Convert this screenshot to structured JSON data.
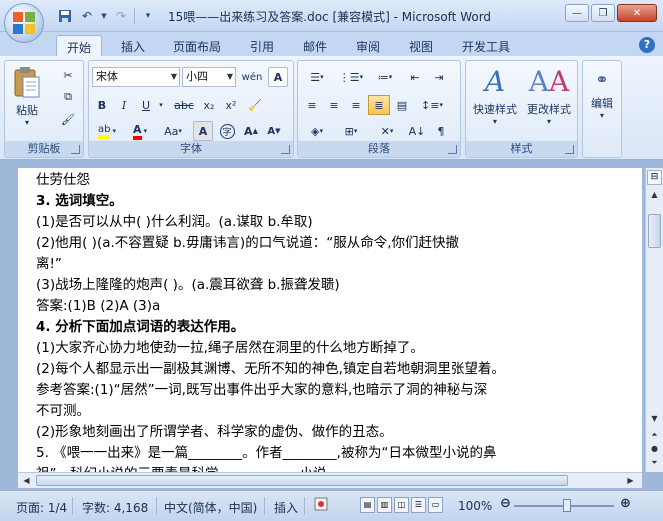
{
  "title_bar": {
    "title": "15喂——出来练习及答案.doc [兼容模式] - Microsoft Word",
    "qat": {
      "save_icon": "save-icon",
      "undo_icon": "undo-icon",
      "redo_icon": "redo-icon"
    }
  },
  "tabs": [
    "开始",
    "插入",
    "页面布局",
    "引用",
    "邮件",
    "审阅",
    "视图",
    "开发工具"
  ],
  "ribbon": {
    "clipboard": {
      "paste_label": "粘贴",
      "group_label": "剪贴板"
    },
    "font": {
      "font_name": "宋体",
      "font_size": "小四",
      "group_label": "字体",
      "bold": "B",
      "italic": "I",
      "underline": "U",
      "strike": "abc",
      "subscript": "x₂",
      "superscript": "x²",
      "grow": "A",
      "shrink": "A",
      "change_case": "Aa"
    },
    "paragraph": {
      "group_label": "段落"
    },
    "styles": {
      "quick_styles_label": "快速样式",
      "change_styles_label": "更改样式",
      "group_label": "样式"
    },
    "editing": {
      "label": "编辑"
    }
  },
  "document": {
    "lines": [
      "仕劳仕怨",
      "3. 选词填空。",
      "(1)是否可以从中(  )什么利润。(a.谋取   b.牟取)",
      "(2)他用(  )(a.不容置疑   b.毋庸讳言)的口气说道：“服从命令,你们赶快撤",
      "离!”",
      "(3)战场上隆隆的炮声(  )。(a.震耳欲聋   b.振聋发聩)",
      "答案:(1)B   (2)A   (3)a",
      "4. 分析下面加点词语的表达作用。",
      "(1)大家齐心协力地使劲一拉,绳子居然在洞里的什么地方断掉了。",
      "(2)每个人都显示出一副极其渊博、无所不知的神色,镇定自若地朝洞里张望着。",
      "参考答案:(1)“居然”一词,既写出事件出乎大家的意料,也暗示了洞的神秘与深",
      "不可测。",
      "(2)形象地刻画出了所谓学者、科学家的虚伪、做作的丑态。",
      "5. 《喂一一出来》是一篇________。作者________,被称为“日本微型小说的鼻",
      "祖”。科幻小说的三要素是科学、________、小说。"
    ]
  },
  "status_bar": {
    "page": "页面: 1/4",
    "words": "字数: 4,168",
    "language": "中文(简体，中国)",
    "mode": "插入",
    "zoom": "100%"
  },
  "colors": {
    "highlight": "#ffff00",
    "font_color": "#ff0000",
    "accent": "#2f6fc4"
  }
}
